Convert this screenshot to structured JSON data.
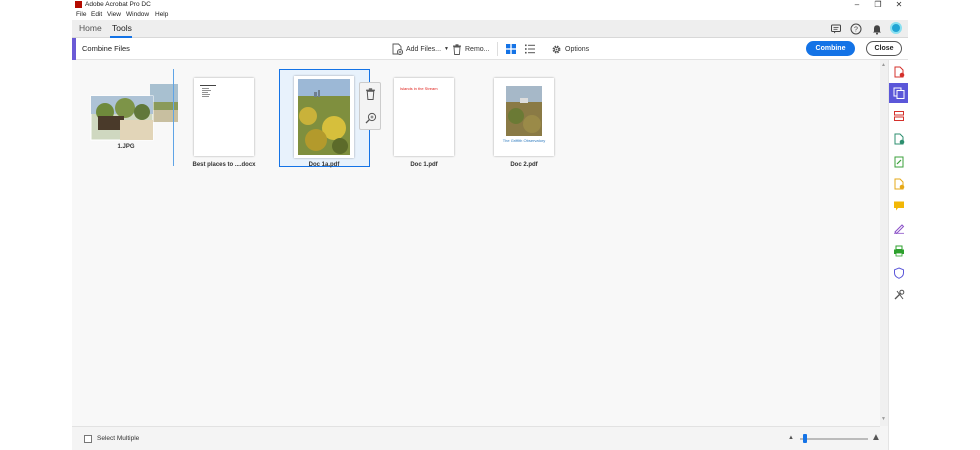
{
  "window": {
    "title": "Adobe Acrobat Pro DC",
    "minimize": "–",
    "maximize": "❐",
    "close": "✕"
  },
  "menu": [
    "File",
    "Edit",
    "View",
    "Window",
    "Help"
  ],
  "tabs": [
    {
      "label": "Home"
    },
    {
      "label": "Tools"
    }
  ],
  "toolbar": {
    "title": "Combine Files",
    "add_files": "Add Files...",
    "remove": "Remo...",
    "options": "Options",
    "combine": "Combine",
    "close": "Close"
  },
  "files": [
    {
      "name": "1.JPG"
    },
    {
      "name": "Best places to ....docx"
    },
    {
      "name": "Doc 1a.pdf"
    },
    {
      "name": "Doc 1.pdf",
      "page_text": "Islands in the Stream"
    },
    {
      "name": "Doc 2.pdf",
      "page_text": "The Griffith Observatory"
    }
  ],
  "status": {
    "select_multiple": "Select Multiple",
    "select_multiple_checked": false,
    "zoom_level": 0.05
  },
  "colors": {
    "accent": "#1473e6",
    "brand_red": "#b30b00",
    "tool_accent": "#6b5bd6",
    "doc1_text": "#e0231e",
    "doc2_text": "#2f7bbf"
  },
  "icons": [
    "chat-icon",
    "help-icon",
    "bell-icon",
    "trash-icon",
    "zoom-in-icon",
    "grid-view-icon",
    "list-view-icon",
    "gear-icon",
    "add-file-icon"
  ]
}
